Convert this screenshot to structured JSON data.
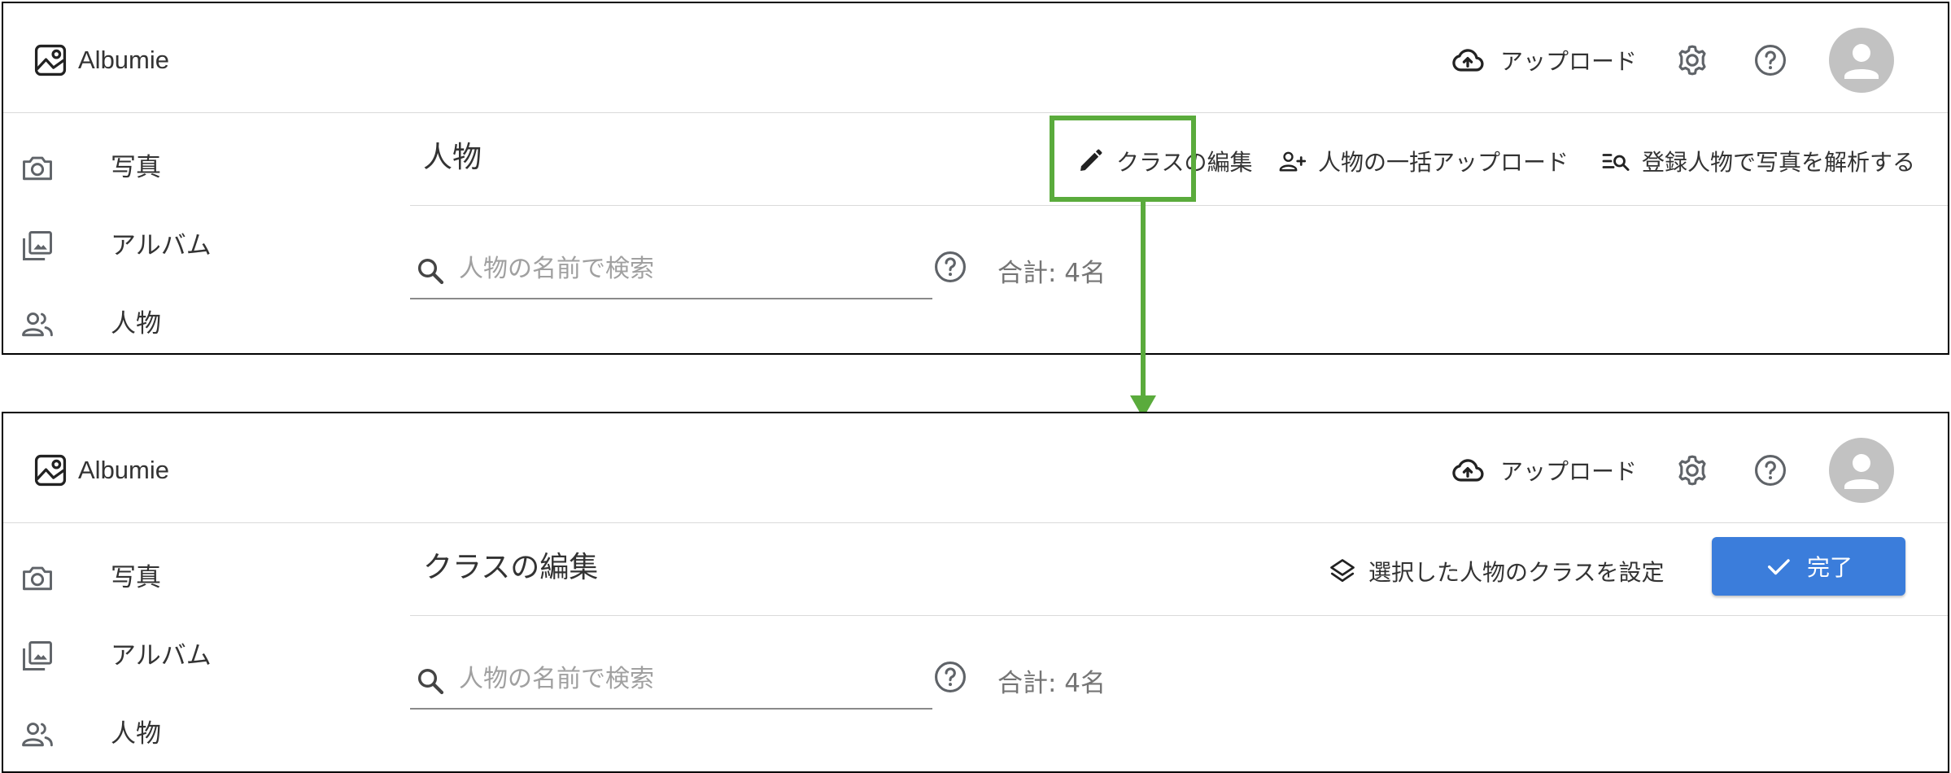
{
  "app": {
    "name": "Albumie"
  },
  "header": {
    "upload_label": "アップロード"
  },
  "sidebar": {
    "items": [
      {
        "label": "写真",
        "icon": "camera-icon"
      },
      {
        "label": "アルバム",
        "icon": "photo-library-icon"
      },
      {
        "label": "人物",
        "icon": "people-icon"
      }
    ]
  },
  "screen1": {
    "title": "人物",
    "actions": {
      "edit_class": "クラスの編集",
      "bulk_upload": "人物の一括アップロード",
      "analyze": "登録人物で写真を解析する"
    },
    "search_placeholder": "人物の名前で検索",
    "total": "合計: 4名"
  },
  "screen2": {
    "title": "クラスの編集",
    "actions": {
      "set_class": "選択した人物のクラスを設定",
      "done": "完了"
    },
    "search_placeholder": "人物の名前で検索",
    "total": "合計: 4名"
  },
  "colors": {
    "highlight": "#5aab3c",
    "primary": "#3b7ddb",
    "avatar_bg": "#c2c2c2",
    "icon": "#5f6368"
  }
}
